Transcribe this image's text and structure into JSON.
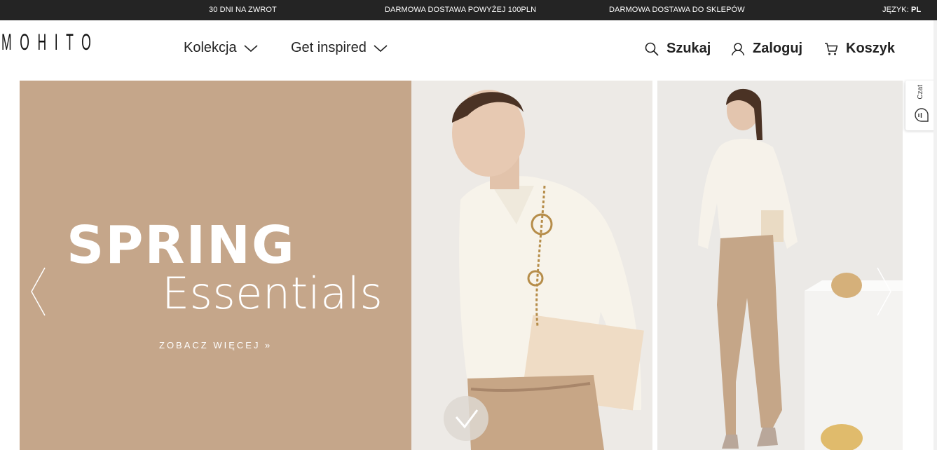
{
  "topbar": {
    "returns": "30 DNI NA ZWROT",
    "free_delivery": "DARMOWA DOSTAWA POWYŻEJ 100PLN",
    "store_delivery": "DARMOWA DOSTAWA DO SKLEPÓW",
    "language_label": "JĘZYK:",
    "language_value": "PL"
  },
  "header": {
    "logo": "MOHITO",
    "nav": [
      {
        "label": "Kolekcja",
        "icon": "chevron-down-icon"
      },
      {
        "label": "Get inspired",
        "icon": "chevron-down-icon"
      }
    ],
    "utilities": {
      "search": {
        "label": "Szukaj",
        "icon": "search-icon"
      },
      "login": {
        "label": "Zaloguj",
        "icon": "user-icon"
      },
      "cart": {
        "label": "Koszyk",
        "icon": "cart-icon"
      }
    }
  },
  "hero": {
    "headline": "SPRING",
    "subheadline": "Essentials",
    "cta": "ZOBACZ WIĘCEJ »",
    "background_color": "#c5a68a"
  },
  "chat": {
    "label": "Czat",
    "icon": "chat-icon"
  }
}
